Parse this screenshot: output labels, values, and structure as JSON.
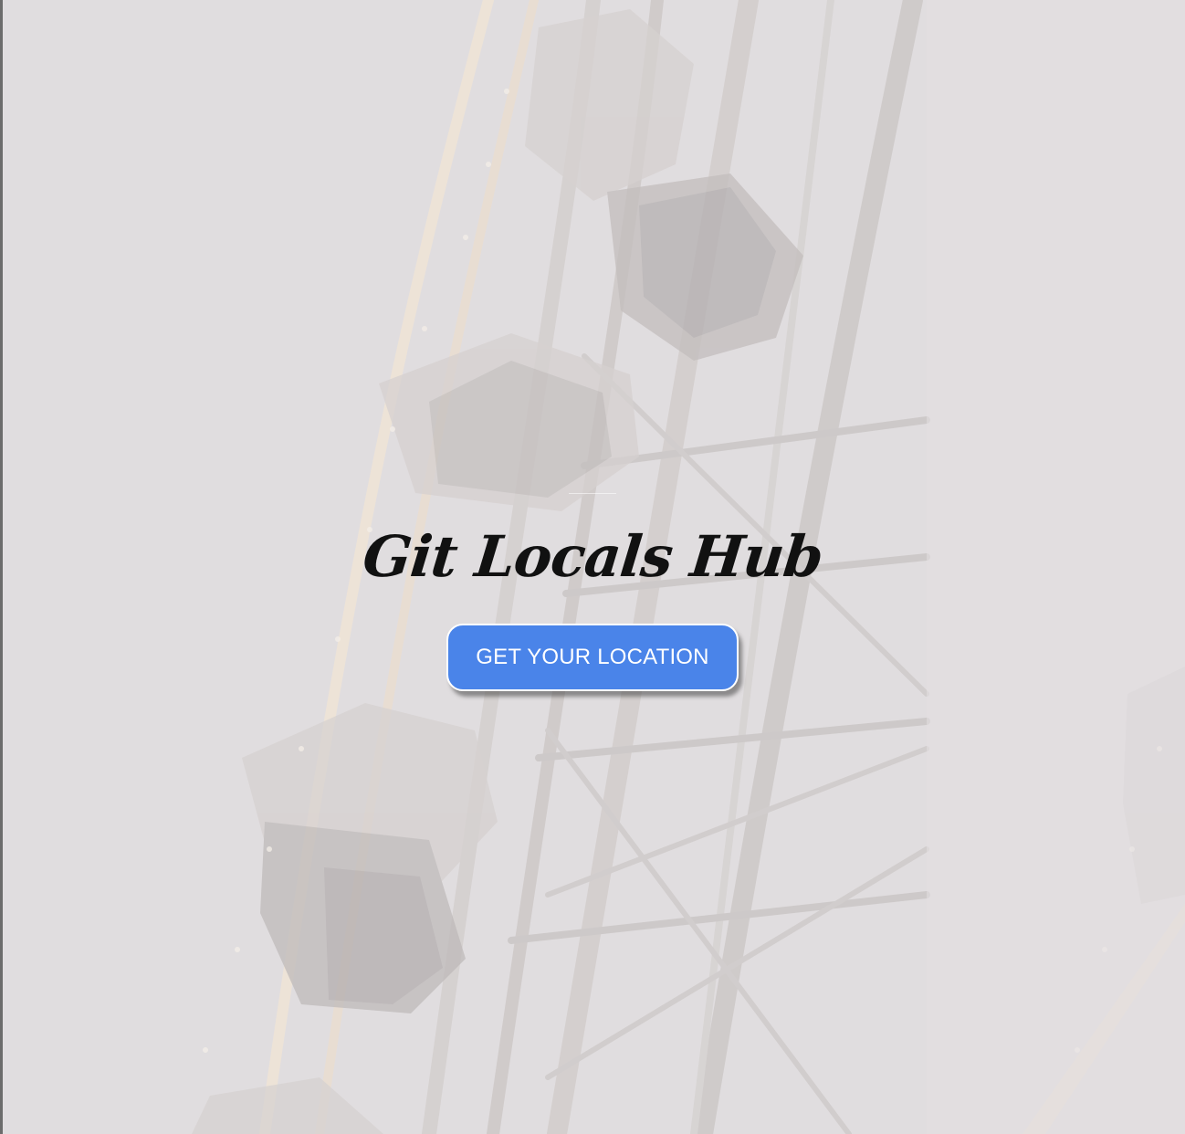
{
  "app": {
    "title": "Git Locals Hub"
  },
  "hero": {
    "button_label": "GET YOUR LOCATION"
  },
  "background": {
    "subject_icon": "ferris-wheel-photo",
    "colors": {
      "page": "#dfdcdd",
      "button": "#4a84e9",
      "button_text": "#ffffff",
      "title": "#111111"
    }
  }
}
